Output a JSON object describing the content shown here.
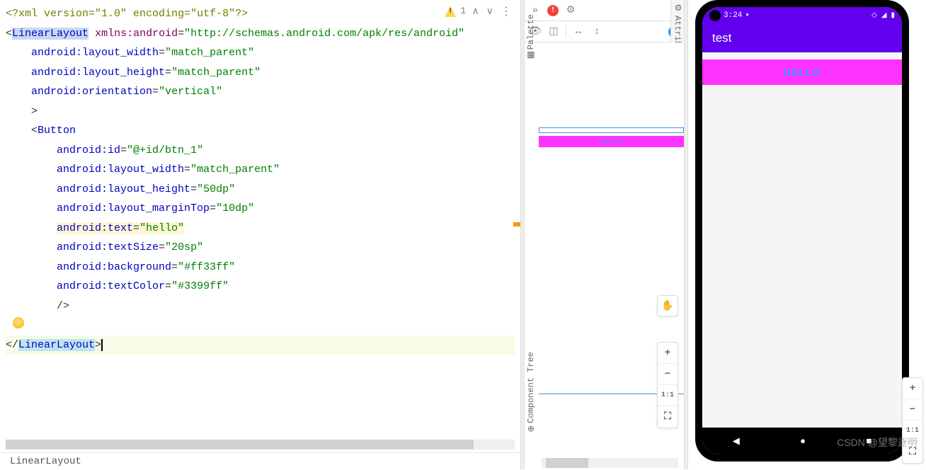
{
  "warnings": {
    "count": "1"
  },
  "code": {
    "prolog_pre": "<?",
    "prolog_xml": "xml",
    "prolog_attrs": " version=\"1.0\" encoding=\"utf-8\"",
    "prolog_post": "?>",
    "root_open": "<",
    "root": "LinearLayout",
    "xmlns_key": "xmlns:android",
    "xmlns_val": "\"http://schemas.android.com/apk/res/android\"",
    "attrs": [
      {
        "key": "android:layout_width",
        "val": "\"match_parent\""
      },
      {
        "key": "android:layout_height",
        "val": "\"match_parent\""
      },
      {
        "key": "android:orientation",
        "val": "\"vertical\""
      }
    ],
    "close_angle": ">",
    "btn_open": "<",
    "btn": "Button",
    "battrs": [
      {
        "key": "android:id",
        "val": "\"@+id/btn_1\""
      },
      {
        "key": "android:layout_width",
        "val": "\"match_parent\""
      },
      {
        "key": "android:layout_height",
        "val": "\"50dp\""
      },
      {
        "key": "android:layout_marginTop",
        "val": "\"10dp\""
      },
      {
        "key": "android:text",
        "val": "\"hello\""
      },
      {
        "key": "android:textSize",
        "val": "\"20sp\""
      },
      {
        "key": "android:background",
        "val": "\"#ff33ff\""
      },
      {
        "key": "android:textColor",
        "val": "\"#3399ff\""
      }
    ],
    "btn_close": "/>",
    "end_open": "</",
    "end_tag": "LinearLayout",
    "end_close": ">"
  },
  "breadcrumb": "LinearLayout",
  "design": {
    "toolbar": {
      "chev": "»",
      "help": "?"
    },
    "button_text": "HELLO",
    "zoom": {
      "pan": "✋",
      "plus": "+",
      "minus": "−",
      "oneone": "1:1",
      "fit": "⛶"
    },
    "sidetabs": {
      "palette": "Palette",
      "tree": "Component Tree",
      "attrs": "Attributes"
    }
  },
  "emulator": {
    "status_time": "3:24",
    "status_icons": "◇ ◢ ▮",
    "app_title": "test",
    "button_text": "HELLO",
    "nav": {
      "back": "◀",
      "home": "●",
      "recent": "■"
    },
    "zoom": {
      "plus": "+",
      "minus": "−",
      "oneone": "1:1",
      "fit": "⛶"
    }
  },
  "watermark": "CSDN @望黎逐明"
}
